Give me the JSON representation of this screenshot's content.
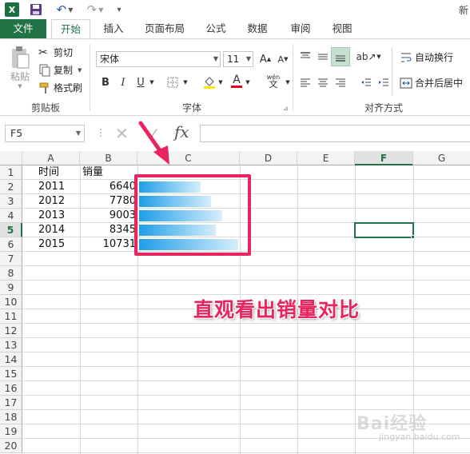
{
  "title_bar": {
    "logo_text": "X",
    "title_partial": "新"
  },
  "tabs": [
    "文件",
    "开始",
    "插入",
    "页面布局",
    "公式",
    "数据",
    "审阅",
    "视图"
  ],
  "clipboard": {
    "paste": "粘贴",
    "cut": "剪切",
    "copy": "复制",
    "format_painter": "格式刷",
    "label": "剪贴板"
  },
  "font": {
    "name": "宋体",
    "size": "11",
    "bold": "B",
    "italic": "I",
    "underline": "U",
    "grow": "A",
    "shrink": "A",
    "phonetic": "wén",
    "label": "字体"
  },
  "alignment": {
    "wrap": "自动换行",
    "merge": "合并后居中",
    "label": "对齐方式"
  },
  "formula_bar": {
    "name_box": "F5",
    "fx": "fx",
    "value": ""
  },
  "columns": [
    "A",
    "B",
    "C",
    "D",
    "E",
    "F",
    "G"
  ],
  "selected_column": "F",
  "rows": [
    "1",
    "2",
    "3",
    "4",
    "5",
    "6",
    "7",
    "8",
    "9",
    "10",
    "11",
    "12",
    "13",
    "14",
    "15",
    "16",
    "17",
    "18",
    "19",
    "20"
  ],
  "selected_row": "5",
  "sheet": {
    "header_time": "时间",
    "header_sales": "销量",
    "data": [
      {
        "year": "2011",
        "sales": "6640",
        "value": 6640
      },
      {
        "year": "2012",
        "sales": "7780",
        "value": 7780
      },
      {
        "year": "2013",
        "sales": "9003",
        "value": 9003
      },
      {
        "year": "2014",
        "sales": "8345",
        "value": 8345
      },
      {
        "year": "2015",
        "sales": "10731",
        "value": 10731
      }
    ],
    "bar_max": 10731,
    "bar_color": "#1e9ee8"
  },
  "annotation": "直观看出销量对比",
  "watermark": {
    "main": "Bai经验",
    "sub": "jingyan.baidu.com"
  },
  "colors": {
    "excel_green": "#217346",
    "highlight": "#e8255f"
  }
}
